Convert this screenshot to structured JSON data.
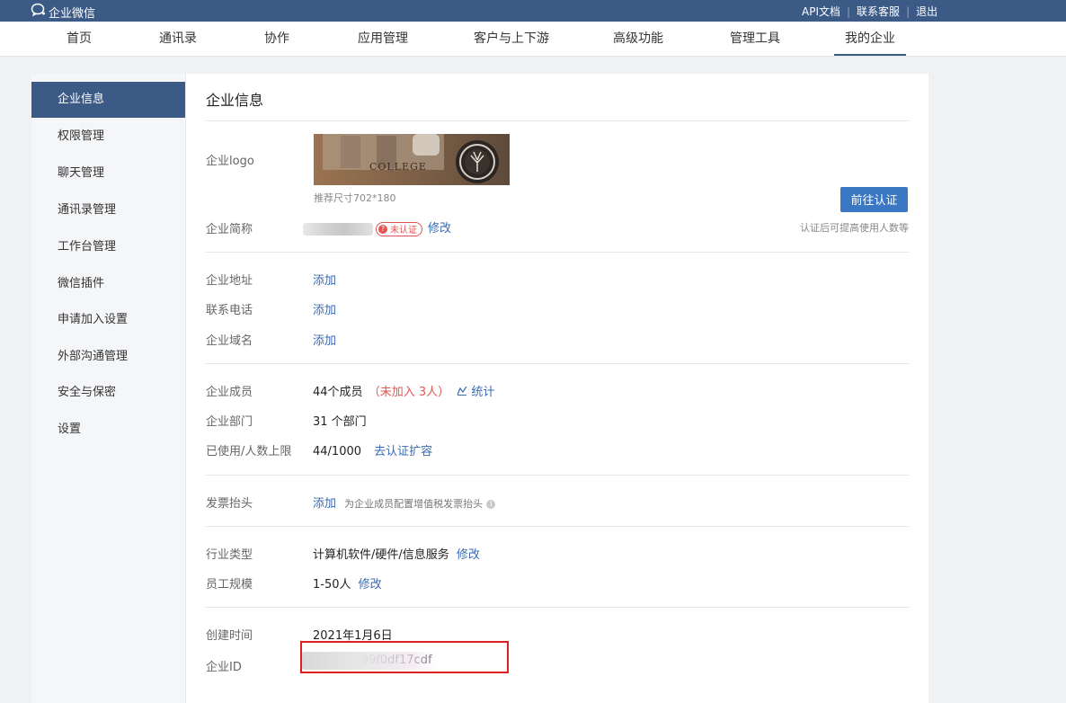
{
  "topbar": {
    "brand": "企业微信",
    "links": [
      "API文档",
      "联系客服",
      "退出"
    ],
    "separator": "|"
  },
  "nav": {
    "tabs": [
      "首页",
      "通讯录",
      "协作",
      "应用管理",
      "客户与上下游",
      "高级功能",
      "管理工具",
      "我的企业"
    ],
    "active": "我的企业"
  },
  "sidebar": {
    "items": [
      "企业信息",
      "权限管理",
      "聊天管理",
      "通讯录管理",
      "工作台管理",
      "微信插件",
      "申请加入设置",
      "外部沟通管理",
      "安全与保密",
      "设置"
    ],
    "active": "企业信息"
  },
  "main": {
    "title": "企业信息",
    "logo": {
      "label": "企业logo",
      "hint": "推荐尺寸702*180",
      "partial_text": "COLLEGE"
    },
    "short_name": {
      "label": "企业简称",
      "badge": "未认证",
      "badge_icon": "?",
      "edit": "修改"
    },
    "auth": {
      "button": "前往认证",
      "tip": "认证后可提高使用人数等"
    },
    "address": {
      "label": "企业地址",
      "action": "添加"
    },
    "phone": {
      "label": "联系电话",
      "action": "添加"
    },
    "domain": {
      "label": "企业域名",
      "action": "添加"
    },
    "members": {
      "label": "企业成员",
      "count": "44个成员",
      "pending": "（未加入 3人）",
      "stats_icon": "stats-chart-icon",
      "stats": "统计"
    },
    "departments": {
      "label": "企业部门",
      "value": "31 个部门"
    },
    "usage": {
      "label": "已使用/人数上限",
      "value": "44/1000",
      "action": "去认证扩容"
    },
    "invoice": {
      "label": "发票抬头",
      "action": "添加",
      "hint": "为企业成员配置增值税发票抬头",
      "info_icon": "info-icon"
    },
    "industry": {
      "label": "行业类型",
      "value": "计算机软件/硬件/信息服务",
      "edit": "修改"
    },
    "scale": {
      "label": "员工规模",
      "value": "1-50人",
      "edit": "修改"
    },
    "created": {
      "label": "创建时间",
      "value": "2021年1月6日"
    },
    "corp_id": {
      "label": "企业ID",
      "value_visible": "b1099f0df17cdf"
    }
  },
  "colors": {
    "topbar": "#3c5a86",
    "accent": "#3a78c3",
    "link": "#3a6ab1",
    "warning": "#e25454",
    "highlight": "#e02020"
  }
}
